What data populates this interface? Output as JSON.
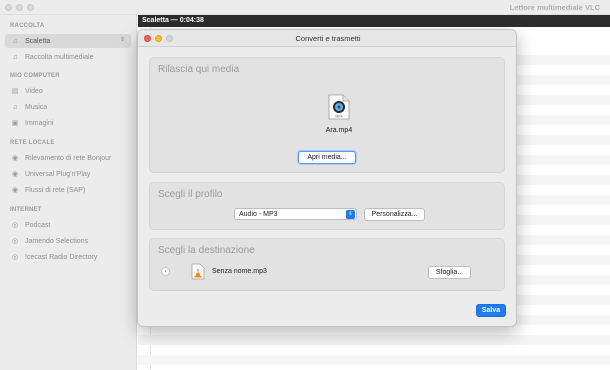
{
  "main_window": {
    "title": "Lettore multimediale VLC"
  },
  "sidebar": {
    "sections": [
      {
        "title": "RACCOLTA",
        "items": [
          {
            "label": "Scaletta",
            "icon": "playlist-icon",
            "glyph": "♫"
          },
          {
            "label": "Raccolta multimediale",
            "icon": "library-icon",
            "glyph": "♫"
          }
        ]
      },
      {
        "title": "MIO COMPUTER",
        "items": [
          {
            "label": "Video",
            "icon": "film-icon",
            "glyph": "▤"
          },
          {
            "label": "Musica",
            "icon": "music-icon",
            "glyph": "♫"
          },
          {
            "label": "Immagini",
            "icon": "image-icon",
            "glyph": "▣"
          }
        ]
      },
      {
        "title": "RETE LOCALE",
        "items": [
          {
            "label": "Rilevamento di rete Bonjour",
            "icon": "network-icon",
            "glyph": "◉"
          },
          {
            "label": "Universal Plug'n'Play",
            "icon": "network-icon",
            "glyph": "◉"
          },
          {
            "label": "Flussi di rete (SAP)",
            "icon": "network-icon",
            "glyph": "◉"
          }
        ]
      },
      {
        "title": "INTERNET",
        "items": [
          {
            "label": "Podcast",
            "icon": "podcast-icon",
            "glyph": "◎"
          },
          {
            "label": "Jamendo Selections",
            "icon": "podcast-icon",
            "glyph": "◎"
          },
          {
            "label": "Icecast Radio Directory",
            "icon": "podcast-icon",
            "glyph": "◎"
          }
        ]
      }
    ]
  },
  "playlist": {
    "header": "Scaletta — 0:04:38"
  },
  "dialog": {
    "title": "Converti e trasmetti",
    "drop": {
      "title": "Rilascia qui media",
      "file_name": "Ara.mp4",
      "file_badge": "MP4",
      "open_button": "Apri media..."
    },
    "profile": {
      "title": "Scegli il profilo",
      "selected": "Audio - MP3",
      "customize_button": "Personalizza..."
    },
    "destination": {
      "title": "Scegli la destinazione",
      "file_name": "Senza nome.mp3",
      "browse_button": "Sfoglia..."
    },
    "save_button": "Salva"
  },
  "colors": {
    "accent": "#1d7cf2",
    "close": "#fe5f57",
    "minimize": "#febc2e",
    "vlc_orange": "#f08a1c"
  }
}
